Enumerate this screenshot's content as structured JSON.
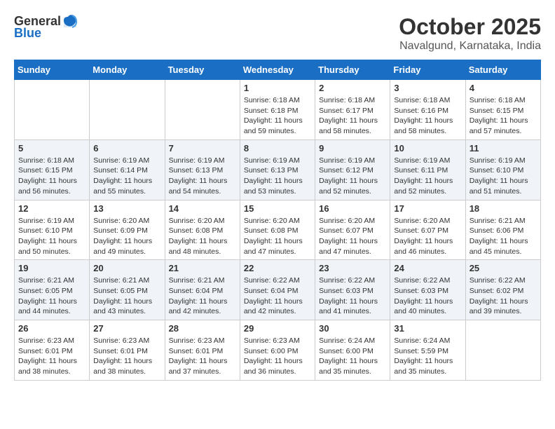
{
  "logo": {
    "text_general": "General",
    "text_blue": "Blue"
  },
  "title": "October 2025",
  "location": "Navalgund, Karnataka, India",
  "weekdays": [
    "Sunday",
    "Monday",
    "Tuesday",
    "Wednesday",
    "Thursday",
    "Friday",
    "Saturday"
  ],
  "weeks": [
    [
      {
        "day": "",
        "sunrise": "",
        "sunset": "",
        "daylight": ""
      },
      {
        "day": "",
        "sunrise": "",
        "sunset": "",
        "daylight": ""
      },
      {
        "day": "",
        "sunrise": "",
        "sunset": "",
        "daylight": ""
      },
      {
        "day": "1",
        "sunrise": "Sunrise: 6:18 AM",
        "sunset": "Sunset: 6:18 PM",
        "daylight": "Daylight: 11 hours and 59 minutes."
      },
      {
        "day": "2",
        "sunrise": "Sunrise: 6:18 AM",
        "sunset": "Sunset: 6:17 PM",
        "daylight": "Daylight: 11 hours and 58 minutes."
      },
      {
        "day": "3",
        "sunrise": "Sunrise: 6:18 AM",
        "sunset": "Sunset: 6:16 PM",
        "daylight": "Daylight: 11 hours and 58 minutes."
      },
      {
        "day": "4",
        "sunrise": "Sunrise: 6:18 AM",
        "sunset": "Sunset: 6:15 PM",
        "daylight": "Daylight: 11 hours and 57 minutes."
      }
    ],
    [
      {
        "day": "5",
        "sunrise": "Sunrise: 6:18 AM",
        "sunset": "Sunset: 6:15 PM",
        "daylight": "Daylight: 11 hours and 56 minutes."
      },
      {
        "day": "6",
        "sunrise": "Sunrise: 6:19 AM",
        "sunset": "Sunset: 6:14 PM",
        "daylight": "Daylight: 11 hours and 55 minutes."
      },
      {
        "day": "7",
        "sunrise": "Sunrise: 6:19 AM",
        "sunset": "Sunset: 6:13 PM",
        "daylight": "Daylight: 11 hours and 54 minutes."
      },
      {
        "day": "8",
        "sunrise": "Sunrise: 6:19 AM",
        "sunset": "Sunset: 6:13 PM",
        "daylight": "Daylight: 11 hours and 53 minutes."
      },
      {
        "day": "9",
        "sunrise": "Sunrise: 6:19 AM",
        "sunset": "Sunset: 6:12 PM",
        "daylight": "Daylight: 11 hours and 52 minutes."
      },
      {
        "day": "10",
        "sunrise": "Sunrise: 6:19 AM",
        "sunset": "Sunset: 6:11 PM",
        "daylight": "Daylight: 11 hours and 52 minutes."
      },
      {
        "day": "11",
        "sunrise": "Sunrise: 6:19 AM",
        "sunset": "Sunset: 6:10 PM",
        "daylight": "Daylight: 11 hours and 51 minutes."
      }
    ],
    [
      {
        "day": "12",
        "sunrise": "Sunrise: 6:19 AM",
        "sunset": "Sunset: 6:10 PM",
        "daylight": "Daylight: 11 hours and 50 minutes."
      },
      {
        "day": "13",
        "sunrise": "Sunrise: 6:20 AM",
        "sunset": "Sunset: 6:09 PM",
        "daylight": "Daylight: 11 hours and 49 minutes."
      },
      {
        "day": "14",
        "sunrise": "Sunrise: 6:20 AM",
        "sunset": "Sunset: 6:08 PM",
        "daylight": "Daylight: 11 hours and 48 minutes."
      },
      {
        "day": "15",
        "sunrise": "Sunrise: 6:20 AM",
        "sunset": "Sunset: 6:08 PM",
        "daylight": "Daylight: 11 hours and 47 minutes."
      },
      {
        "day": "16",
        "sunrise": "Sunrise: 6:20 AM",
        "sunset": "Sunset: 6:07 PM",
        "daylight": "Daylight: 11 hours and 47 minutes."
      },
      {
        "day": "17",
        "sunrise": "Sunrise: 6:20 AM",
        "sunset": "Sunset: 6:07 PM",
        "daylight": "Daylight: 11 hours and 46 minutes."
      },
      {
        "day": "18",
        "sunrise": "Sunrise: 6:21 AM",
        "sunset": "Sunset: 6:06 PM",
        "daylight": "Daylight: 11 hours and 45 minutes."
      }
    ],
    [
      {
        "day": "19",
        "sunrise": "Sunrise: 6:21 AM",
        "sunset": "Sunset: 6:05 PM",
        "daylight": "Daylight: 11 hours and 44 minutes."
      },
      {
        "day": "20",
        "sunrise": "Sunrise: 6:21 AM",
        "sunset": "Sunset: 6:05 PM",
        "daylight": "Daylight: 11 hours and 43 minutes."
      },
      {
        "day": "21",
        "sunrise": "Sunrise: 6:21 AM",
        "sunset": "Sunset: 6:04 PM",
        "daylight": "Daylight: 11 hours and 42 minutes."
      },
      {
        "day": "22",
        "sunrise": "Sunrise: 6:22 AM",
        "sunset": "Sunset: 6:04 PM",
        "daylight": "Daylight: 11 hours and 42 minutes."
      },
      {
        "day": "23",
        "sunrise": "Sunrise: 6:22 AM",
        "sunset": "Sunset: 6:03 PM",
        "daylight": "Daylight: 11 hours and 41 minutes."
      },
      {
        "day": "24",
        "sunrise": "Sunrise: 6:22 AM",
        "sunset": "Sunset: 6:03 PM",
        "daylight": "Daylight: 11 hours and 40 minutes."
      },
      {
        "day": "25",
        "sunrise": "Sunrise: 6:22 AM",
        "sunset": "Sunset: 6:02 PM",
        "daylight": "Daylight: 11 hours and 39 minutes."
      }
    ],
    [
      {
        "day": "26",
        "sunrise": "Sunrise: 6:23 AM",
        "sunset": "Sunset: 6:01 PM",
        "daylight": "Daylight: 11 hours and 38 minutes."
      },
      {
        "day": "27",
        "sunrise": "Sunrise: 6:23 AM",
        "sunset": "Sunset: 6:01 PM",
        "daylight": "Daylight: 11 hours and 38 minutes."
      },
      {
        "day": "28",
        "sunrise": "Sunrise: 6:23 AM",
        "sunset": "Sunset: 6:01 PM",
        "daylight": "Daylight: 11 hours and 37 minutes."
      },
      {
        "day": "29",
        "sunrise": "Sunrise: 6:23 AM",
        "sunset": "Sunset: 6:00 PM",
        "daylight": "Daylight: 11 hours and 36 minutes."
      },
      {
        "day": "30",
        "sunrise": "Sunrise: 6:24 AM",
        "sunset": "Sunset: 6:00 PM",
        "daylight": "Daylight: 11 hours and 35 minutes."
      },
      {
        "day": "31",
        "sunrise": "Sunrise: 6:24 AM",
        "sunset": "Sunset: 5:59 PM",
        "daylight": "Daylight: 11 hours and 35 minutes."
      },
      {
        "day": "",
        "sunrise": "",
        "sunset": "",
        "daylight": ""
      }
    ]
  ]
}
